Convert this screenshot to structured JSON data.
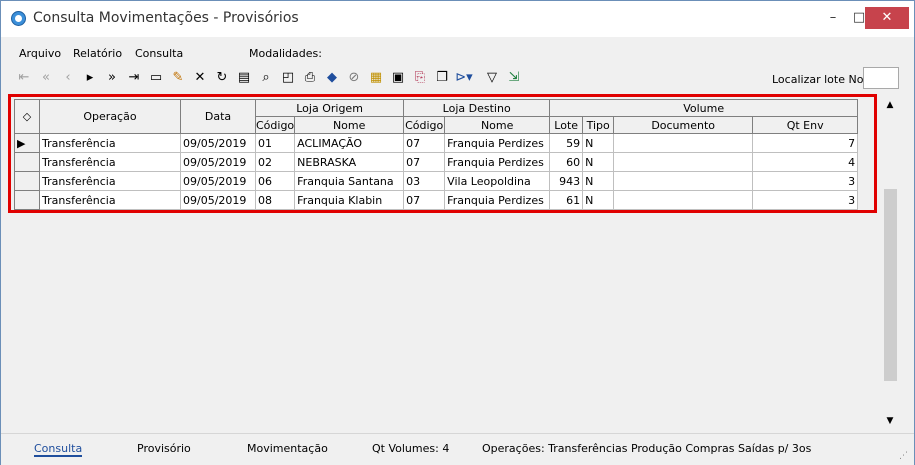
{
  "window": {
    "title": "Consulta Movimentações - Provisórios",
    "min_glyph": "–",
    "max_glyph": "□",
    "close_glyph": "✕"
  },
  "menu": {
    "arquivo": "Arquivo",
    "relatorio": "Relatório",
    "consulta": "Consulta",
    "modalidades": "Modalidades:"
  },
  "toolbar": {
    "icons": [
      "first-icon",
      "prev-page-icon",
      "prev-icon",
      "next-icon",
      "next-page-icon",
      "last-icon",
      "new-icon",
      "edit-icon",
      "delete-icon",
      "refresh-icon",
      "properties-icon",
      "search-icon",
      "preview-icon",
      "print-icon",
      "tag-icon",
      "goto-icon",
      "filter-icon",
      "save-icon",
      "export-icon",
      "window-icon",
      "view-icon",
      "funnel-icon",
      "exit-icon"
    ],
    "localizar_label": "Localizar lote No",
    "localizar_value": ""
  },
  "grid": {
    "group_headers": {
      "loja_origem": "Loja Origem",
      "loja_destino": "Loja Destino",
      "volume": "Volume"
    },
    "columns": {
      "operacao": "Operação",
      "data": "Data",
      "codigo": "Código",
      "nome": "Nome",
      "codigo2": "Código",
      "nome2": "Nome",
      "lote": "Lote",
      "tipo": "Tipo",
      "documento": "Documento",
      "qt_env": "Qt Env"
    },
    "rows": [
      {
        "operacao": "Transferência",
        "data": "09/05/2019",
        "orig_cod": "01",
        "orig_nome": "ACLIMAÇÃO",
        "dest_cod": "07",
        "dest_nome": "Franquia Perdizes",
        "lote": "59",
        "tipo": "N",
        "documento": "",
        "qt_env": "7"
      },
      {
        "operacao": "Transferência",
        "data": "09/05/2019",
        "orig_cod": "02",
        "orig_nome": "NEBRASKA",
        "dest_cod": "07",
        "dest_nome": "Franquia Perdizes",
        "lote": "60",
        "tipo": "N",
        "documento": "",
        "qt_env": "4"
      },
      {
        "operacao": "Transferência",
        "data": "09/05/2019",
        "orig_cod": "06",
        "orig_nome": "Franquia Santana",
        "dest_cod": "03",
        "dest_nome": "Vila Leopoldina",
        "lote": "943",
        "tipo": "N",
        "documento": "",
        "qt_env": "3"
      },
      {
        "operacao": "Transferência",
        "data": "09/05/2019",
        "orig_cod": "08",
        "orig_nome": "Franquia Klabin",
        "dest_cod": "07",
        "dest_nome": "Franquia Perdizes",
        "lote": "61",
        "tipo": "N",
        "documento": "",
        "qt_env": "3"
      }
    ]
  },
  "status": {
    "consulta": "Consulta",
    "provisorio": "Provisório",
    "movimentacao": "Movimentação",
    "qt_volumes": "Qt Volumes: 4",
    "operacoes": "Operações:  Transferências Produção Compras Saídas p/ 3os"
  },
  "colors": {
    "highlight": "#e00000",
    "close": "#c7434c",
    "active_tab": "#1f4e9d"
  }
}
